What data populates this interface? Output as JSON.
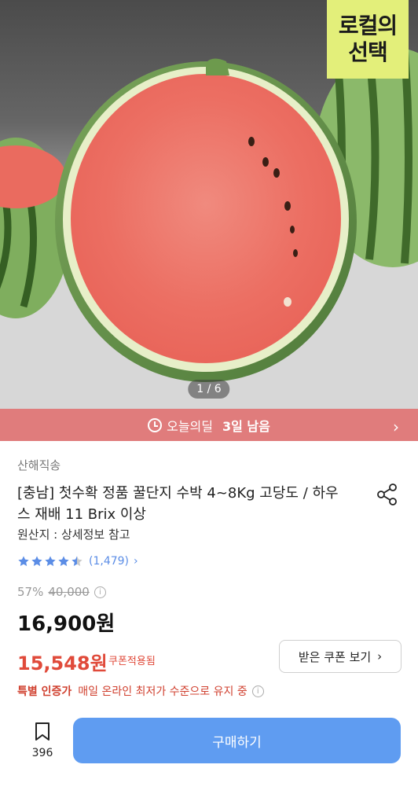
{
  "hero": {
    "badge_line1": "로컬의",
    "badge_line2": "선택",
    "page_indicator": "1 / 6"
  },
  "deal": {
    "label": "오늘의딜",
    "remaining": "3일 남음"
  },
  "product": {
    "seller": "산해직송",
    "title": "[충남] 첫수확 정품 꿀단지 수박 4~8Kg 고당도 / 하우스 재배 11 Brix 이상",
    "origin": "원산지 : 상세정보 참고",
    "rating_value": 4.5,
    "rating_count": "(1,479)",
    "discount_percent": "57%",
    "original_price": "40,000",
    "price": "16,900원",
    "coupon_price": "15,548원",
    "coupon_applied_label": "쿠폰적용됨",
    "coupon_button_label": "받은 쿠폰 보기",
    "promo_bold": "특별 인증가",
    "promo_text": "매일 온라인 최저가 수준으로 유지 중"
  },
  "bottom_bar": {
    "bookmark_count": "396",
    "buy_label": "구매하기"
  },
  "colors": {
    "deal_bar": "#e07c7c",
    "accent_red": "#e04a3a",
    "buy_blue": "#5f9cf1",
    "star_blue": "#5b8de6",
    "badge_yellow": "#e3ef7a"
  }
}
